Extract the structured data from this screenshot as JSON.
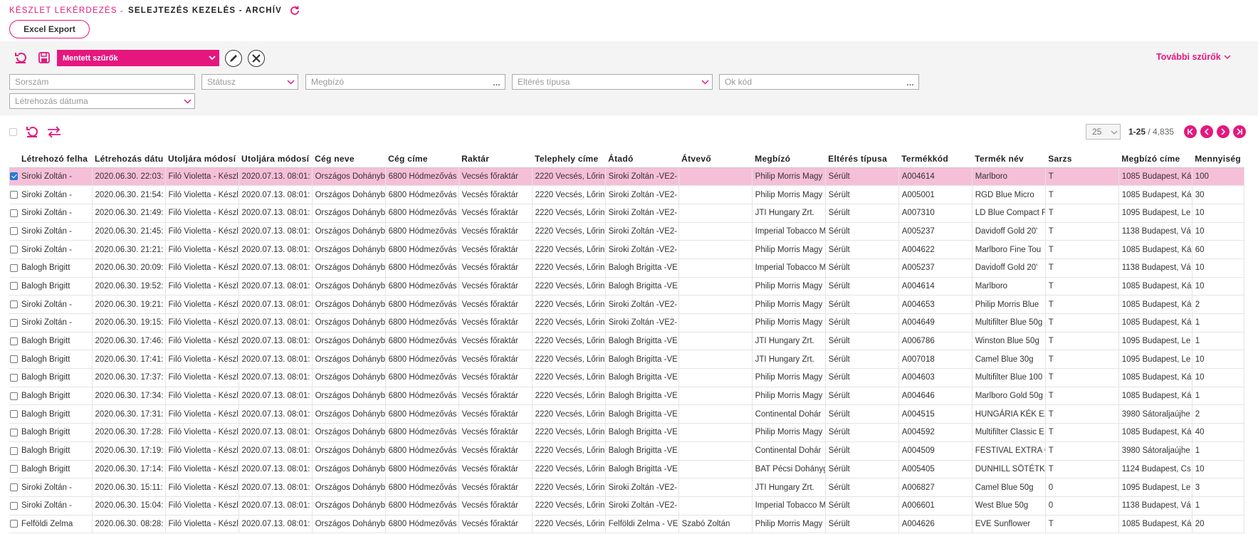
{
  "header": {
    "breadcrumb": "Készlet lekérdezés",
    "separator": "-",
    "title": "Selejtezés kezelés - archív",
    "export_label": "Excel Export"
  },
  "filters": {
    "saved_filters_label": "Mentett szűrők",
    "more_filters_label": "További szűrők",
    "fields": {
      "serial": "Sorszám",
      "status": "Státusz",
      "client": "Megbízó",
      "diff_type": "Eltérés típusa",
      "reason_code": "Ok kód",
      "created_date": "Létrehozás dátuma"
    }
  },
  "pager": {
    "page_size": "25",
    "range": "1-25",
    "separator": " / ",
    "total": "4,835"
  },
  "colors": {
    "accent": "#e5177e",
    "selected_row": "#f6bfd8"
  },
  "table": {
    "columns": [
      "Létrehozó felha",
      "Létrehozás dátu",
      "Utoljára módosí",
      "Utoljára módosí",
      "Cég neve",
      "Cég címe",
      "Raktár",
      "Telephely címe",
      "Átadó",
      "Átvevő",
      "Megbízó",
      "Eltérés típusa",
      "Termékkód",
      "Termék név",
      "Sarzs",
      "Megbízó címe",
      "Mennyiség"
    ],
    "rows": [
      {
        "sel": true,
        "c": [
          "Siroki Zoltán -",
          "2020.06.30. 22:03:",
          "Filó Violetta - Készl",
          "2020.07.13. 08:01:",
          "Országos Dohányb",
          "6800 Hódmezővás",
          "Vecsés főraktár",
          "2220 Vecsés, Lőrin",
          "Siroki Zoltán -VE2-",
          "",
          "Philip Morris Magy",
          "Sérült",
          "A004614",
          "Marlboro",
          "T",
          "1085 Budapest, Ká",
          "100"
        ]
      },
      {
        "sel": false,
        "c": [
          "Siroki Zoltán -",
          "2020.06.30. 21:54:",
          "Filó Violetta - Készl",
          "2020.07.13. 08:01:",
          "Országos Dohányb",
          "6800 Hódmezővás",
          "Vecsés főraktár",
          "2220 Vecsés, Lőrin",
          "Siroki Zoltán -VE2-",
          "",
          "Philip Morris Magy",
          "Sérült",
          "A005001",
          "RGD Blue Micro",
          "T",
          "1085 Budapest, Ká",
          "30"
        ]
      },
      {
        "sel": false,
        "c": [
          "Siroki Zoltán -",
          "2020.06.30. 21:49:",
          "Filó Violetta - Készl",
          "2020.07.13. 08:01:",
          "Országos Dohányb",
          "6800 Hódmezővás",
          "Vecsés főraktár",
          "2220 Vecsés, Lőrin",
          "Siroki Zoltán -VE2-",
          "",
          "JTI Hungary Zrt.",
          "Sérült",
          "A007310",
          "LD Blue Compact F",
          "T",
          "1095 Budapest, Le",
          "10"
        ]
      },
      {
        "sel": false,
        "c": [
          "Siroki Zoltán -",
          "2020.06.30. 21:45:",
          "Filó Violetta - Készl",
          "2020.07.13. 08:01:",
          "Országos Dohányb",
          "6800 Hódmezővás",
          "Vecsés főraktár",
          "2220 Vecsés, Lőrin",
          "Siroki Zoltán -VE2-",
          "",
          "Imperial Tobacco M",
          "Sérült",
          "A005237",
          "Davidoff Gold 20'",
          "T",
          "1138 Budapest, Vá",
          "10"
        ]
      },
      {
        "sel": false,
        "c": [
          "Siroki Zoltán -",
          "2020.06.30. 21:21:",
          "Filó Violetta - Készl",
          "2020.07.13. 08:01:",
          "Országos Dohányb",
          "6800 Hódmezővás",
          "Vecsés főraktár",
          "2220 Vecsés, Lőrin",
          "Siroki Zoltán -VE2-",
          "",
          "Philip Morris Magy",
          "Sérült",
          "A004622",
          "Marlboro Fine Tou",
          "T",
          "1085 Budapest, Ká",
          "60"
        ]
      },
      {
        "sel": false,
        "c": [
          "Balogh Brigitt",
          "2020.06.30. 20:09:",
          "Filó Violetta - Készl",
          "2020.07.13. 08:01:",
          "Országos Dohányb",
          "6800 Hódmezővás",
          "Vecsés főraktár",
          "2220 Vecsés, Lőrin",
          "Balogh Brigitta -VE",
          "",
          "Imperial Tobacco M",
          "Sérült",
          "A005237",
          "Davidoff Gold 20'",
          "T",
          "1138 Budapest, Vá",
          "10"
        ]
      },
      {
        "sel": false,
        "c": [
          "Balogh Brigitt",
          "2020.06.30. 19:52:",
          "Filó Violetta - Készl",
          "2020.07.13. 08:01:",
          "Országos Dohányb",
          "6800 Hódmezővás",
          "Vecsés főraktár",
          "2220 Vecsés, Lőrin",
          "Balogh Brigitta -VE",
          "",
          "Philip Morris Magy",
          "Sérült",
          "A004614",
          "Marlboro",
          "T",
          "1085 Budapest, Ká",
          "10"
        ]
      },
      {
        "sel": false,
        "c": [
          "Siroki Zoltán -",
          "2020.06.30. 19:21:",
          "Filó Violetta - Készl",
          "2020.07.13. 08:01:",
          "Országos Dohányb",
          "6800 Hódmezővás",
          "Vecsés főraktár",
          "2220 Vecsés, Lőrin",
          "Siroki Zoltán -VE2-",
          "",
          "Philip Morris Magy",
          "Sérült",
          "A004653",
          "Philip Morris Blue",
          "T",
          "1085 Budapest, Ká",
          "2"
        ]
      },
      {
        "sel": false,
        "c": [
          "Siroki Zoltán -",
          "2020.06.30. 19:15:",
          "Filó Violetta - Készl",
          "2020.07.13. 08:01:",
          "Országos Dohányb",
          "6800 Hódmezővás",
          "Vecsés főraktár",
          "2220 Vecsés, Lőrin",
          "Siroki Zoltán -VE2-",
          "",
          "Philip Morris Magy",
          "Sérült",
          "A004649",
          "Multifilter Blue 50g",
          "T",
          "1085 Budapest, Ká",
          "1"
        ]
      },
      {
        "sel": false,
        "c": [
          "Balogh Brigitt",
          "2020.06.30. 17:46:",
          "Filó Violetta - Készl",
          "2020.07.13. 08:01:",
          "Országos Dohányb",
          "6800 Hódmezővás",
          "Vecsés főraktár",
          "2220 Vecsés, Lőrin",
          "Balogh Brigitta -VE",
          "",
          "JTI Hungary Zrt.",
          "Sérült",
          "A006786",
          "Winston Blue 50g",
          "T",
          "1095 Budapest, Le",
          "1"
        ]
      },
      {
        "sel": false,
        "c": [
          "Balogh Brigitt",
          "2020.06.30. 17:41:",
          "Filó Violetta - Készl",
          "2020.07.13. 08:01:",
          "Országos Dohányb",
          "6800 Hódmezővás",
          "Vecsés főraktár",
          "2220 Vecsés, Lőrin",
          "Balogh Brigitta -VE",
          "",
          "JTI Hungary Zrt.",
          "Sérült",
          "A007018",
          "Camel Blue 30g",
          "T",
          "1095 Budapest, Le",
          "10"
        ]
      },
      {
        "sel": false,
        "c": [
          "Balogh Brigitt",
          "2020.06.30. 17:37:",
          "Filó Violetta - Készl",
          "2020.07.13. 08:01:",
          "Országos Dohányb",
          "6800 Hódmezővás",
          "Vecsés főraktár",
          "2220 Vecsés, Lőrin",
          "Balogh Brigitta -VE",
          "",
          "Philip Morris Magy",
          "Sérült",
          "A004603",
          "Multifilter Blue 100",
          "T",
          "1085 Budapest, Ká",
          "10"
        ]
      },
      {
        "sel": false,
        "c": [
          "Balogh Brigitt",
          "2020.06.30. 17:34:",
          "Filó Violetta - Készl",
          "2020.07.13. 08:01:",
          "Országos Dohányb",
          "6800 Hódmezővás",
          "Vecsés főraktár",
          "2220 Vecsés, Lőrin",
          "Balogh Brigitta -VE",
          "",
          "Philip Morris Magy",
          "Sérült",
          "A004646",
          "Marlboro Gold 50g",
          "T",
          "1085 Budapest, Ká",
          "1"
        ]
      },
      {
        "sel": false,
        "c": [
          "Balogh Brigitt",
          "2020.06.30. 17:31:",
          "Filó Violetta - Készl",
          "2020.07.13. 08:01:",
          "Országos Dohányb",
          "6800 Hódmezővás",
          "Vecsés főraktár",
          "2220 Vecsés, Lőrin",
          "Balogh Brigitta -VE",
          "",
          "Continental Dohár",
          "Sérült",
          "A004515",
          "HUNGÁRIA KÉK EX",
          "T",
          "3980 Sátoraljaújhe",
          "2"
        ]
      },
      {
        "sel": false,
        "c": [
          "Balogh Brigitt",
          "2020.06.30. 17:28:",
          "Filó Violetta - Készl",
          "2020.07.13. 08:01:",
          "Országos Dohányb",
          "6800 Hódmezővás",
          "Vecsés főraktár",
          "2220 Vecsés, Lőrin",
          "Balogh Brigitta -VE",
          "",
          "Philip Morris Magy",
          "Sérült",
          "A004592",
          "Multifilter Classic E",
          "T",
          "1085 Budapest, Ká",
          "40"
        ]
      },
      {
        "sel": false,
        "c": [
          "Balogh Brigitt",
          "2020.06.30. 17:19:",
          "Filó Violetta - Készl",
          "2020.07.13. 08:01:",
          "Országos Dohányb",
          "6800 Hódmezővás",
          "Vecsés főraktár",
          "2220 Vecsés, Lőrin",
          "Balogh Brigitta -VE",
          "",
          "Continental Dohár",
          "Sérült",
          "A004509",
          "FESTIVAL EXTRA CI",
          "T",
          "3980 Sátoraljaújhe",
          "1"
        ]
      },
      {
        "sel": false,
        "c": [
          "Balogh Brigitt",
          "2020.06.30. 17:14:",
          "Filó Violetta - Készl",
          "2020.07.13. 08:01:",
          "Országos Dohányb",
          "6800 Hódmezővás",
          "Vecsés főraktár",
          "2220 Vecsés, Lőrin",
          "Balogh Brigitta -VE",
          "",
          "BAT Pécsi Dohányg",
          "Sérült",
          "A005405",
          "DUNHILL SÖTÉTKÉ",
          "T",
          "1124 Budapest, Cs",
          "10"
        ]
      },
      {
        "sel": false,
        "c": [
          "Siroki Zoltán -",
          "2020.06.30. 15:11:",
          "Filó Violetta - Készl",
          "2020.07.13. 08:01:",
          "Országos Dohányb",
          "6800 Hódmezővás",
          "Vecsés főraktár",
          "2220 Vecsés, Lőrin",
          "Siroki Zoltán -VE2-",
          "",
          "JTI Hungary Zrt.",
          "Sérült",
          "A006827",
          "Camel Blue 50g",
          "0",
          "1095 Budapest, Le",
          "3"
        ]
      },
      {
        "sel": false,
        "c": [
          "Siroki Zoltán -",
          "2020.06.30. 15:04:",
          "Filó Violetta - Készl",
          "2020.07.13. 08:01:",
          "Országos Dohányb",
          "6800 Hódmezővás",
          "Vecsés főraktár",
          "2220 Vecsés, Lőrin",
          "Siroki Zoltán -VE2-",
          "",
          "Imperial Tobacco M",
          "Sérült",
          "A006601",
          "West Blue 50g",
          "0",
          "1138 Budapest, Vá",
          "1"
        ]
      },
      {
        "sel": false,
        "c": [
          "Felföldi Zelma",
          "2020.06.30. 08:28:",
          "Filó Violetta - Készl",
          "2020.07.13. 08:01:",
          "Országos Dohányb",
          "6800 Hódmezővás",
          "Vecsés főraktár",
          "2220 Vecsés, Lőrin",
          "Felföldi Zelma - VE",
          "Szabó Zoltán",
          "Philip Morris Magy",
          "Sérült",
          "A004626",
          "EVE Sunflower",
          "T",
          "1085 Budapest, Ká",
          "20"
        ]
      }
    ]
  }
}
